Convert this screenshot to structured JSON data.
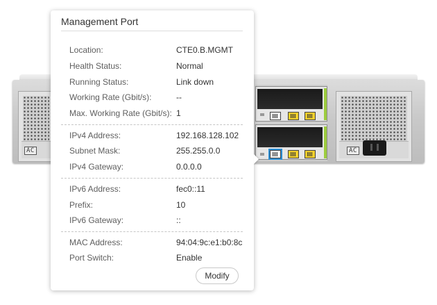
{
  "panel": {
    "title": "Management Port",
    "groups": [
      [
        {
          "label": "Location:",
          "value": "CTE0.B.MGMT"
        },
        {
          "label": "Health Status:",
          "value": "Normal"
        },
        {
          "label": "Running Status:",
          "value": "Link down"
        },
        {
          "label": "Working Rate (Gbit/s):",
          "value": "--"
        },
        {
          "label": "Max. Working Rate (Gbit/s):",
          "value": "1"
        }
      ],
      [
        {
          "label": "IPv4 Address:",
          "value": "192.168.128.102"
        },
        {
          "label": "Subnet Mask:",
          "value": "255.255.0.0"
        },
        {
          "label": "IPv4 Gateway:",
          "value": "0.0.0.0"
        }
      ],
      [
        {
          "label": "IPv6 Address:",
          "value": "fec0::11"
        },
        {
          "label": "Prefix:",
          "value": "10"
        },
        {
          "label": "IPv6 Gateway:",
          "value": "::"
        }
      ],
      [
        {
          "label": "MAC Address:",
          "value": "94:04:9c:e1:b0:8c"
        },
        {
          "label": "Port Switch:",
          "value": "Enable"
        }
      ]
    ],
    "modify_label": "Modify"
  },
  "device": {
    "psu_label": "AC",
    "accent_color": "#9ccc3d",
    "selected_port_color": "#2b8fd6"
  }
}
